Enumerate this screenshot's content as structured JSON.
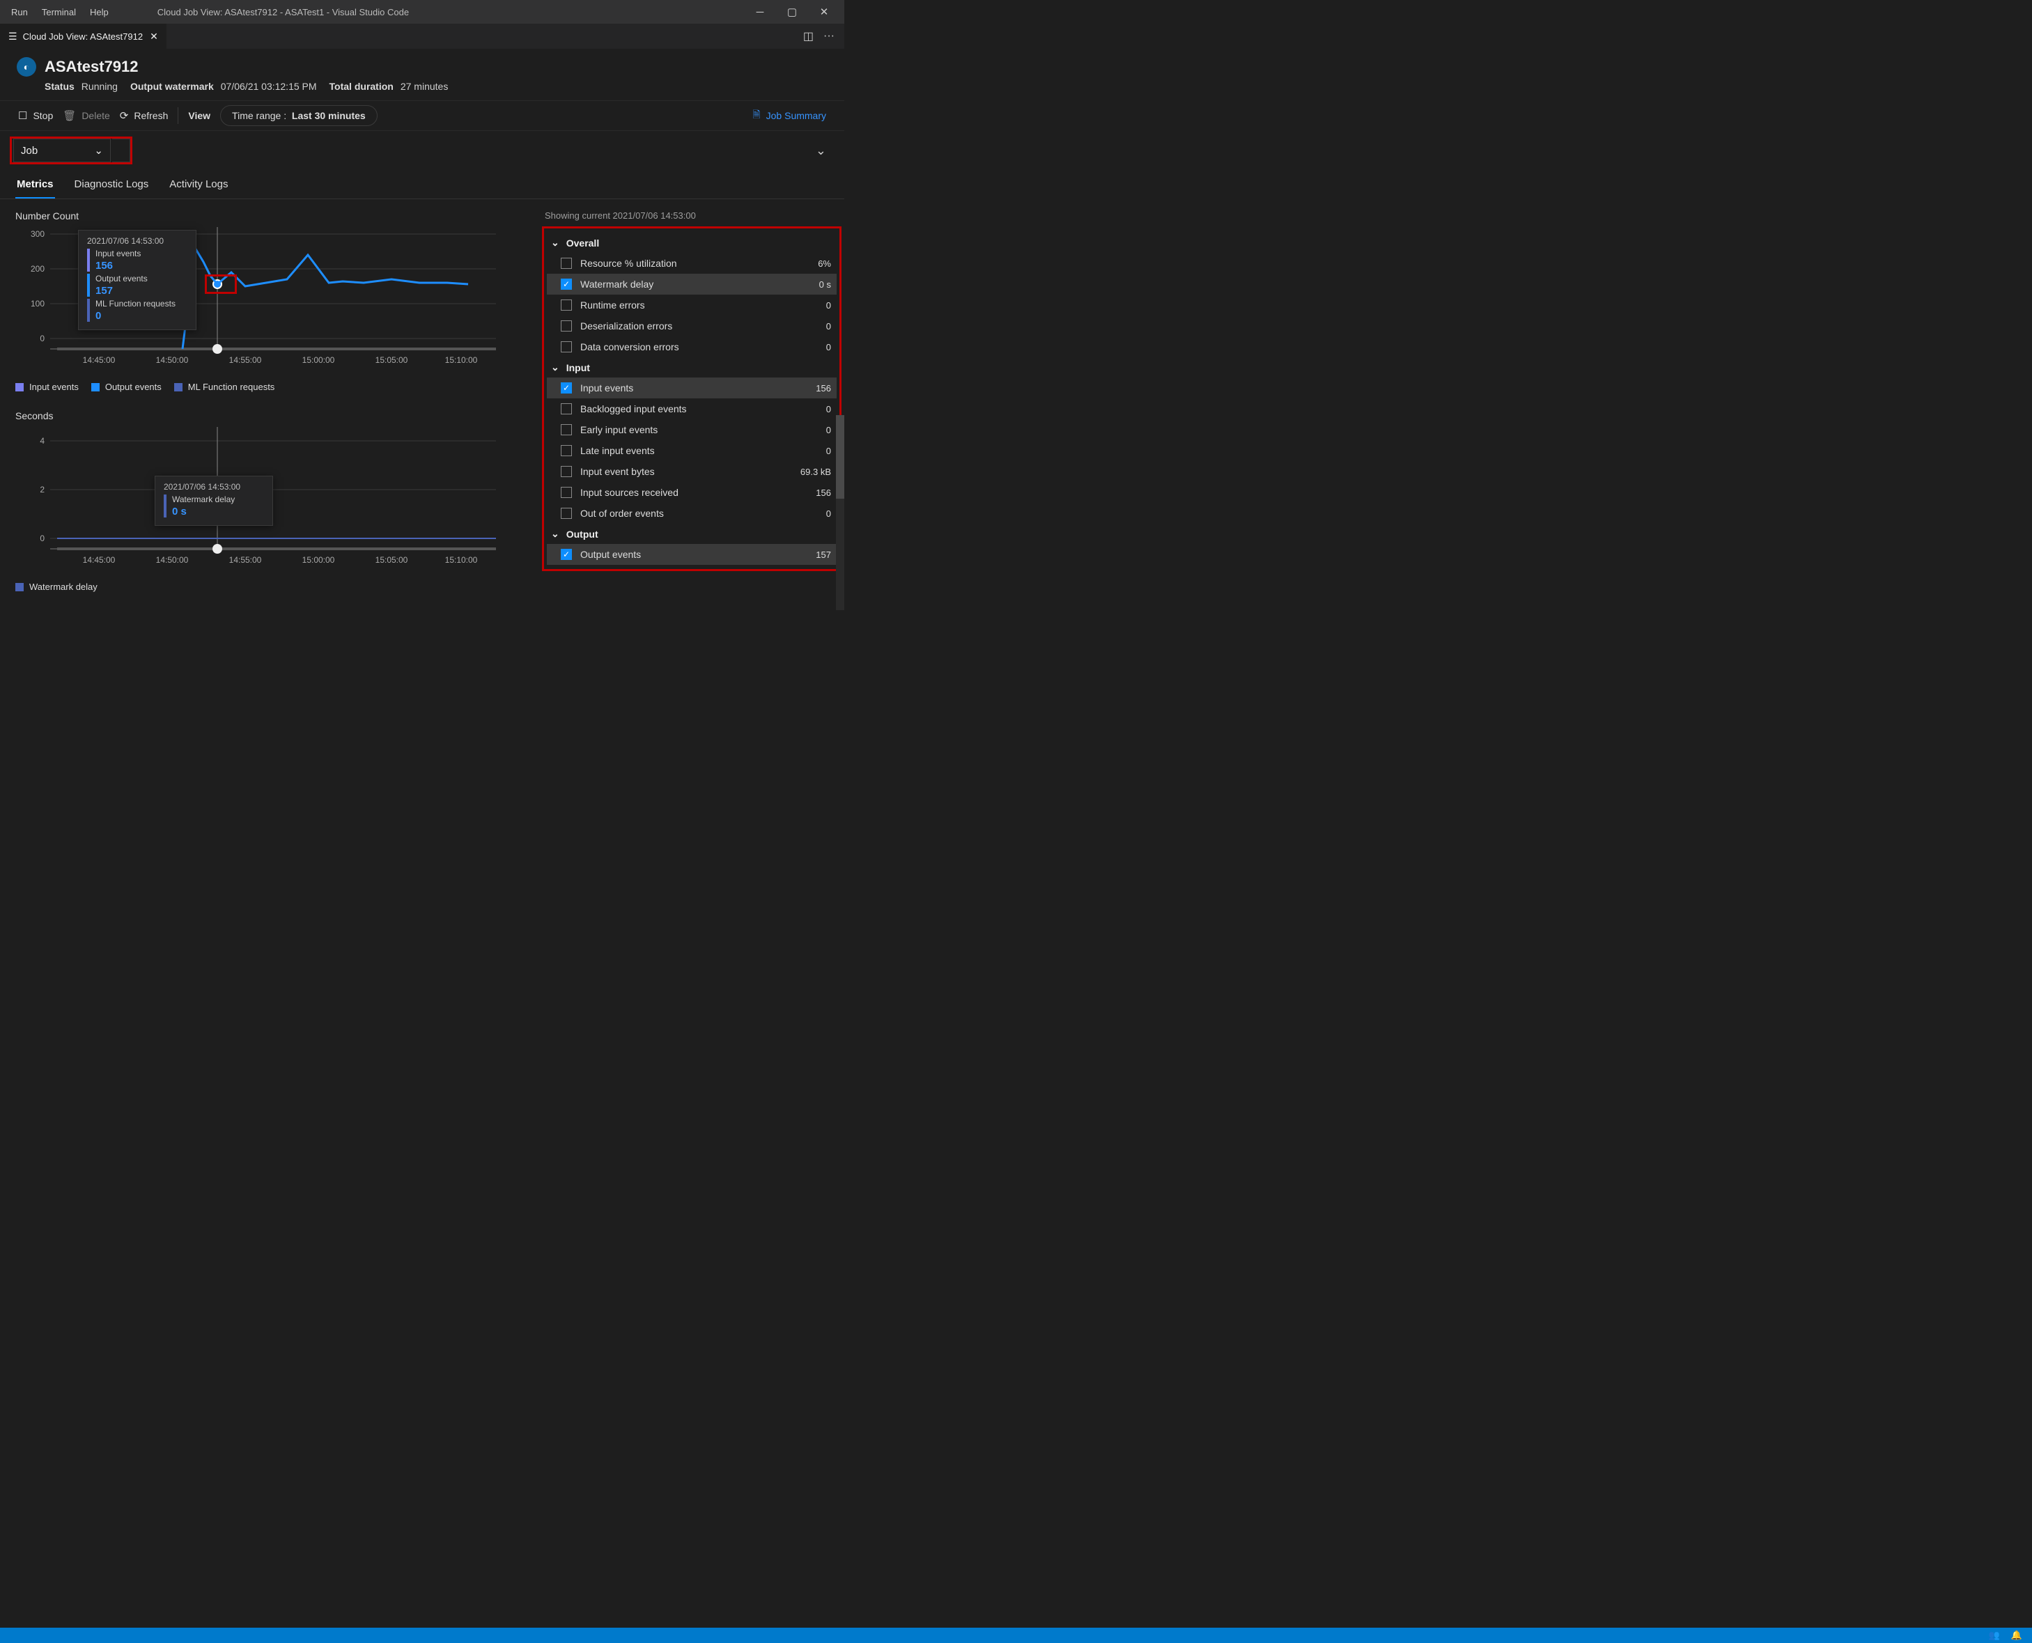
{
  "menu": {
    "items": [
      "Run",
      "Terminal",
      "Help"
    ],
    "title": "Cloud Job View: ASAtest7912 - ASATest1 - Visual Studio Code"
  },
  "tab": {
    "label": "Cloud Job View: ASAtest7912"
  },
  "job": {
    "name": "ASAtest7912",
    "status_label": "Status",
    "status_value": "Running",
    "watermark_label": "Output watermark",
    "watermark_value": "07/06/21 03:12:15 PM",
    "duration_label": "Total duration",
    "duration_value": "27 minutes"
  },
  "toolbar": {
    "stop": "Stop",
    "delete": "Delete",
    "refresh": "Refresh",
    "view": "View",
    "timerange_label": "Time range :",
    "timerange_value": "Last 30 minutes",
    "summary": "Job Summary"
  },
  "scope": {
    "label": "Job"
  },
  "tabs": {
    "metrics": "Metrics",
    "diag": "Diagnostic Logs",
    "activity": "Activity Logs"
  },
  "chart_data": [
    {
      "type": "line",
      "title": "Number Count",
      "x": [
        "14:45:00",
        "14:50:00",
        "14:55:00",
        "15:00:00",
        "15:05:00",
        "15:10:00"
      ],
      "y_ticks": [
        0,
        100,
        200,
        300
      ],
      "series": [
        {
          "name": "Input events",
          "color": "#7a7ff0",
          "values": [
            0,
            0,
            156,
            180,
            170,
            172,
            160,
            175,
            168,
            178,
            170,
            176,
            166,
            172
          ]
        },
        {
          "name": "Output events",
          "color": "#1e8eff",
          "values": [
            0,
            0,
            270,
            210,
            157,
            180,
            160,
            165,
            210,
            168,
            172,
            170,
            176,
            170,
            168,
            176
          ]
        },
        {
          "name": "ML Function requests",
          "color": "#4a63b6",
          "values": [
            0,
            0,
            0,
            0,
            0,
            0,
            0,
            0,
            0,
            0,
            0,
            0,
            0,
            0,
            0,
            0
          ]
        }
      ],
      "cursor_time": "2021/07/06 14:53:00",
      "cursor_values": {
        "Input events": 156,
        "Output events": 157,
        "ML Function requests": 0
      }
    },
    {
      "type": "line",
      "title": "Seconds",
      "x": [
        "14:45:00",
        "14:50:00",
        "14:55:00",
        "15:00:00",
        "15:05:00",
        "15:10:00"
      ],
      "y_ticks": [
        0,
        2,
        4
      ],
      "series": [
        {
          "name": "Watermark delay",
          "color": "#4a63b6",
          "values": [
            0,
            0,
            0,
            0,
            0,
            0,
            0,
            0,
            0,
            0,
            0,
            0,
            0,
            0,
            0,
            0
          ]
        }
      ],
      "cursor_time": "2021/07/06 14:53:00",
      "cursor_values": {
        "Watermark delay": "0 s"
      }
    }
  ],
  "right": {
    "showing": "Showing current 2021/07/06 14:53:00",
    "groups": [
      {
        "name": "Overall",
        "items": [
          {
            "label": "Resource % utilization",
            "value": "6%",
            "checked": false
          },
          {
            "label": "Watermark delay",
            "value": "0 s",
            "checked": true,
            "hl": true
          },
          {
            "label": "Runtime errors",
            "value": "0",
            "checked": false
          },
          {
            "label": "Deserialization errors",
            "value": "0",
            "checked": false
          },
          {
            "label": "Data conversion errors",
            "value": "0",
            "checked": false
          }
        ]
      },
      {
        "name": "Input",
        "items": [
          {
            "label": "Input events",
            "value": "156",
            "checked": true,
            "hl": true
          },
          {
            "label": "Backlogged input events",
            "value": "0",
            "checked": false
          },
          {
            "label": "Early input events",
            "value": "0",
            "checked": false
          },
          {
            "label": "Late input events",
            "value": "0",
            "checked": false
          },
          {
            "label": "Input event bytes",
            "value": "69.3 kB",
            "checked": false
          },
          {
            "label": "Input sources received",
            "value": "156",
            "checked": false
          },
          {
            "label": "Out of order events",
            "value": "0",
            "checked": false
          }
        ]
      },
      {
        "name": "Output",
        "items": [
          {
            "label": "Output events",
            "value": "157",
            "checked": true,
            "hl": true
          }
        ]
      }
    ]
  },
  "legends": {
    "chart1": [
      {
        "label": "Input events",
        "color": "#7a7ff0"
      },
      {
        "label": "Output events",
        "color": "#1e8eff"
      },
      {
        "label": "ML Function requests",
        "color": "#4a63b6"
      }
    ],
    "chart2": [
      {
        "label": "Watermark delay",
        "color": "#4a63b6"
      }
    ]
  },
  "tooltip1": {
    "date": "2021/07/06 14:53:00",
    "rows": [
      {
        "label": "Input events",
        "value": "156",
        "color": "#7a7ff0"
      },
      {
        "label": "Output events",
        "value": "157",
        "color": "#1e8eff"
      },
      {
        "label": "ML Function requests",
        "value": "0",
        "color": "#4a63b6"
      }
    ]
  },
  "tooltip2": {
    "date": "2021/07/06 14:53:00",
    "rows": [
      {
        "label": "Watermark delay",
        "value": "0 s",
        "color": "#4a63b6"
      }
    ]
  }
}
